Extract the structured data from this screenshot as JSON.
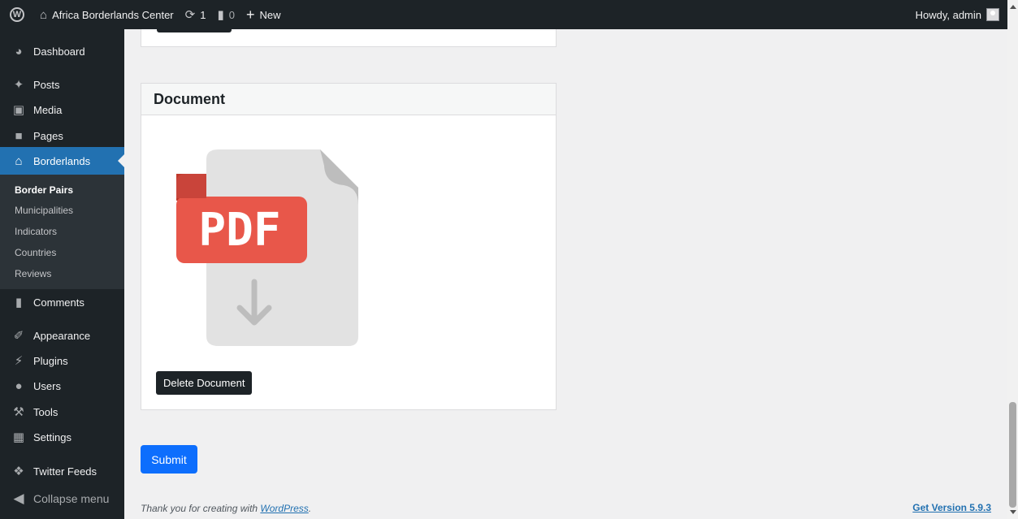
{
  "adminbar": {
    "site_name": "Africa Borderlands Center",
    "updates_count": "1",
    "comments_count": "0",
    "new_label": "New",
    "howdy": "Howdy, admin"
  },
  "sidebar": {
    "items": [
      {
        "label": "Dashboard",
        "icon": "dashboard-icon"
      },
      {
        "label": "Posts",
        "icon": "pin-icon"
      },
      {
        "label": "Media",
        "icon": "media-icon"
      },
      {
        "label": "Pages",
        "icon": "pages-icon"
      },
      {
        "label": "Borderlands",
        "icon": "home-icon"
      },
      {
        "label": "Comments",
        "icon": "comment-icon"
      },
      {
        "label": "Appearance",
        "icon": "brush-icon"
      },
      {
        "label": "Plugins",
        "icon": "plugin-icon"
      },
      {
        "label": "Users",
        "icon": "users-icon"
      },
      {
        "label": "Tools",
        "icon": "wrench-icon"
      },
      {
        "label": "Settings",
        "icon": "settings-icon"
      },
      {
        "label": "Twitter Feeds",
        "icon": "twitter-icon"
      },
      {
        "label": "Collapse menu",
        "icon": "collapse-icon"
      }
    ],
    "submenu": [
      "Border Pairs",
      "Municipalities",
      "Indicators",
      "Countries",
      "Reviews"
    ]
  },
  "document_box": {
    "title": "Document",
    "pdf_text": "PDF",
    "delete_label": "Delete Document"
  },
  "submit_label": "Submit",
  "footer": {
    "thanks_prefix": "Thank you for creating with ",
    "wordpress_link": "WordPress",
    "thanks_suffix": ".",
    "version_link": "Get Version 5.9.3"
  },
  "colors": {
    "admin_dark": "#1d2327",
    "accent_blue": "#2271b1",
    "submit_blue": "#0d6efd",
    "pdf_red": "#e8574a"
  }
}
